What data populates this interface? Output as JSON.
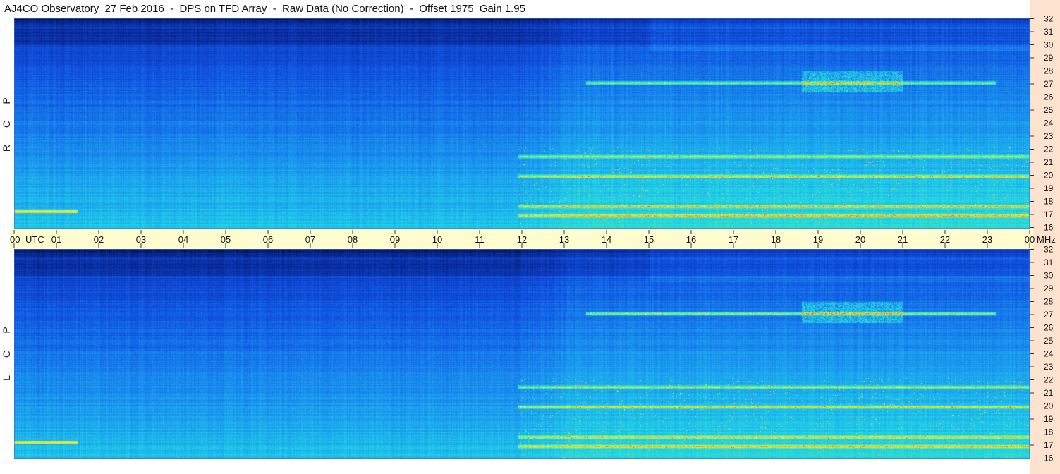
{
  "chart_data": {
    "type": "heatmap",
    "title": "AJ4CO Observatory  27 Feb 2016  -  DPS on TFD Array  -  Raw Data (No Correction)  -  Offset 1975  Gain 1.95",
    "x_axis": {
      "ticks": [
        "00",
        "01",
        "02",
        "03",
        "04",
        "05",
        "06",
        "07",
        "08",
        "09",
        "10",
        "11",
        "12",
        "13",
        "14",
        "15",
        "16",
        "17",
        "18",
        "19",
        "20",
        "21",
        "22",
        "23",
        "00"
      ],
      "utc_label": "UTC",
      "range": [
        0,
        24
      ]
    },
    "y_axis": {
      "unit": "MHz",
      "ticks": [
        "32",
        "31",
        "30",
        "29",
        "28",
        "27",
        "26",
        "25",
        "24",
        "23",
        "22",
        "21",
        "20",
        "19",
        "18",
        "17",
        "16"
      ],
      "range": [
        16,
        32
      ]
    },
    "panels": [
      {
        "name": "R C P",
        "letters": [
          "R",
          "C",
          "P"
        ]
      },
      {
        "name": "L C P",
        "letters": [
          "L",
          "C",
          "P"
        ]
      }
    ],
    "colormap": [
      "#000820",
      "#0a2a9a",
      "#1050e0",
      "#1a90f0",
      "#20d0e8",
      "#40f0b0",
      "#e8f040",
      "#ff9000",
      "#ff2a70"
    ],
    "notes_visible": {
      "strong_bands_mhz": [
        27.1,
        21.5,
        20.0,
        17.7,
        17.0
      ],
      "activity_start_utc": 11.9
    }
  }
}
